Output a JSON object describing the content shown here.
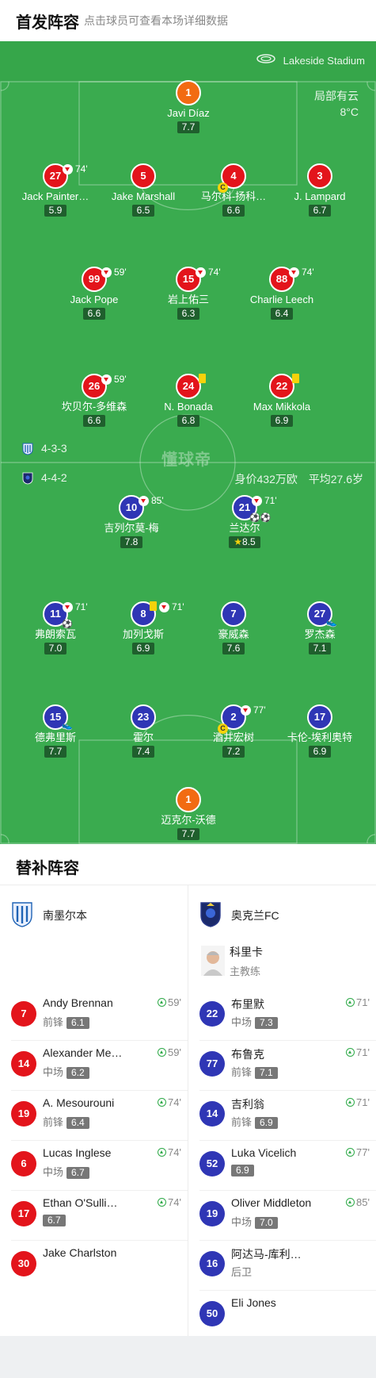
{
  "header": {
    "title": "首发阵容",
    "hint": "点击球员可查看本场详细数据"
  },
  "stadium": {
    "name": "Lakeside Stadium"
  },
  "weather": {
    "condition": "局部有云",
    "temp": "8°C"
  },
  "watermark": "懂球帝",
  "home": {
    "formation": "4-3-3",
    "goalkeeper": {
      "num": "1",
      "name": "Javi Díaz",
      "rating": "7.7"
    },
    "defenders": [
      {
        "num": "27",
        "name": "Jack Painter…",
        "rating": "5.9",
        "sub": "74'"
      },
      {
        "num": "5",
        "name": "Jake Marshall",
        "rating": "6.5"
      },
      {
        "num": "4",
        "name": "马尔科-扬科…",
        "rating": "6.6",
        "captain": "C"
      },
      {
        "num": "3",
        "name": "J. Lampard",
        "rating": "6.7"
      }
    ],
    "midfielders": [
      {
        "num": "99",
        "name": "Jack Pope",
        "rating": "6.6",
        "sub": "59'"
      },
      {
        "num": "15",
        "name": "岩上佑三",
        "rating": "6.3",
        "sub": "74'"
      },
      {
        "num": "88",
        "name": "Charlie Leech",
        "rating": "6.4",
        "sub": "74'"
      }
    ],
    "forwards": [
      {
        "num": "26",
        "name": "坎贝尔-多维森",
        "rating": "6.6",
        "sub": "59'"
      },
      {
        "num": "24",
        "name": "N. Bonada",
        "rating": "6.8"
      },
      {
        "num": "22",
        "name": "Max Mikkola",
        "rating": "6.9"
      }
    ]
  },
  "away": {
    "formation": "4-4-2",
    "value": "身价432万欧",
    "age": "平均27.6岁",
    "forwards": [
      {
        "num": "10",
        "name": "吉列尔莫-梅",
        "rating": "7.8",
        "sub": "85'"
      },
      {
        "num": "21",
        "name": "兰达尔",
        "rating": "8.5",
        "sub": "71'"
      }
    ],
    "midfielders": [
      {
        "num": "11",
        "name": "弗朗索瓦",
        "rating": "7.0",
        "sub": "71'"
      },
      {
        "num": "8",
        "name": "加列戈斯",
        "rating": "6.9",
        "sub": "71'"
      },
      {
        "num": "7",
        "name": "豪威森",
        "rating": "7.6"
      },
      {
        "num": "27",
        "name": "罗杰森",
        "rating": "7.1"
      }
    ],
    "defenders": [
      {
        "num": "15",
        "name": "德弗里斯",
        "rating": "7.7"
      },
      {
        "num": "23",
        "name": "霍尔",
        "rating": "7.4"
      },
      {
        "num": "2",
        "name": "酒井宏树",
        "rating": "7.2",
        "sub": "77'",
        "captain": "C"
      },
      {
        "num": "17",
        "name": "卡伦-埃利奥特",
        "rating": "6.9"
      }
    ],
    "goalkeeper": {
      "num": "1",
      "name": "迈克尔-沃德",
      "rating": "7.7"
    }
  },
  "subs": {
    "title": "替补阵容",
    "home_team": "南墨尔本",
    "away_team": "奥克兰FC",
    "coach": {
      "name": "科里卡",
      "role": "主教练"
    },
    "home_list": [
      {
        "num": "7",
        "name": "Andy Brennan",
        "pos": "前锋",
        "rating": "6.1",
        "in": "59'"
      },
      {
        "num": "14",
        "name": "Alexander Me…",
        "pos": "中场",
        "rating": "6.2",
        "in": "59'"
      },
      {
        "num": "19",
        "name": "A. Mesourouni",
        "pos": "前锋",
        "rating": "6.4",
        "in": "74'"
      },
      {
        "num": "6",
        "name": "Lucas Inglese",
        "pos": "中场",
        "rating": "6.7",
        "in": "74'"
      },
      {
        "num": "17",
        "name": "Ethan O'Sulli…",
        "pos": "",
        "rating": "6.7",
        "in": "74'"
      },
      {
        "num": "30",
        "name": "Jake Charlston",
        "pos": "",
        "rating": "",
        "in": ""
      }
    ],
    "away_list": [
      {
        "num": "22",
        "name": "布里默",
        "pos": "中场",
        "rating": "7.3",
        "in": "71'"
      },
      {
        "num": "77",
        "name": "布鲁克",
        "pos": "前锋",
        "rating": "7.1",
        "in": "71'"
      },
      {
        "num": "14",
        "name": "吉利翁",
        "pos": "前锋",
        "rating": "6.9",
        "in": "71'"
      },
      {
        "num": "52",
        "name": "Luka Vicelich",
        "pos": "",
        "rating": "6.9",
        "in": "77'"
      },
      {
        "num": "19",
        "name": "Oliver Middleton",
        "pos": "中场",
        "rating": "7.0",
        "in": "85'"
      },
      {
        "num": "16",
        "name": "阿达马-库利…",
        "pos": "后卫",
        "rating": "",
        "in": ""
      },
      {
        "num": "50",
        "name": "Eli Jones",
        "pos": "",
        "rating": "",
        "in": ""
      }
    ]
  }
}
